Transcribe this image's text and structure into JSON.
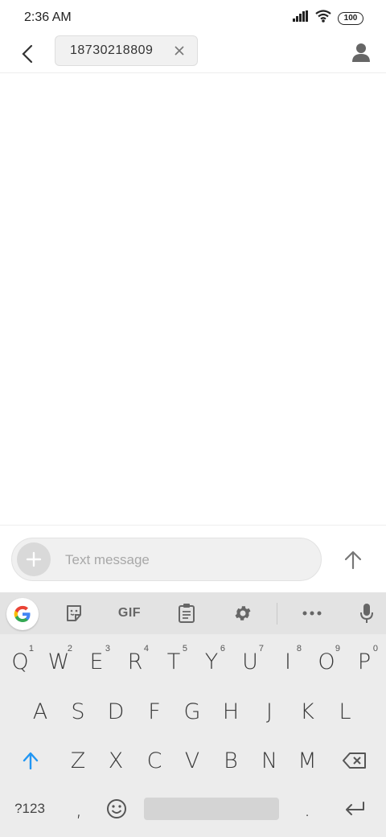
{
  "status_bar": {
    "time": "2:36 AM",
    "battery": "100"
  },
  "header": {
    "recipient": "18730218809"
  },
  "compose": {
    "placeholder": "Text message"
  },
  "keyboard": {
    "toolbar": {
      "gif_label": "GIF"
    },
    "row1": [
      {
        "label": "Q",
        "hint": "1"
      },
      {
        "label": "W",
        "hint": "2"
      },
      {
        "label": "E",
        "hint": "3"
      },
      {
        "label": "R",
        "hint": "4"
      },
      {
        "label": "T",
        "hint": "5"
      },
      {
        "label": "Y",
        "hint": "6"
      },
      {
        "label": "U",
        "hint": "7"
      },
      {
        "label": "I",
        "hint": "8"
      },
      {
        "label": "O",
        "hint": "9"
      },
      {
        "label": "P",
        "hint": "0"
      }
    ],
    "row2": [
      "A",
      "S",
      "D",
      "F",
      "G",
      "H",
      "J",
      "K",
      "L"
    ],
    "row3": [
      "Z",
      "X",
      "C",
      "V",
      "B",
      "N",
      "M"
    ],
    "symbols_label": "?123",
    "comma_label": ",",
    "period_label": "."
  },
  "colors": {
    "accent_blue": "#2196f3",
    "keyboard_bg": "#ececec"
  }
}
